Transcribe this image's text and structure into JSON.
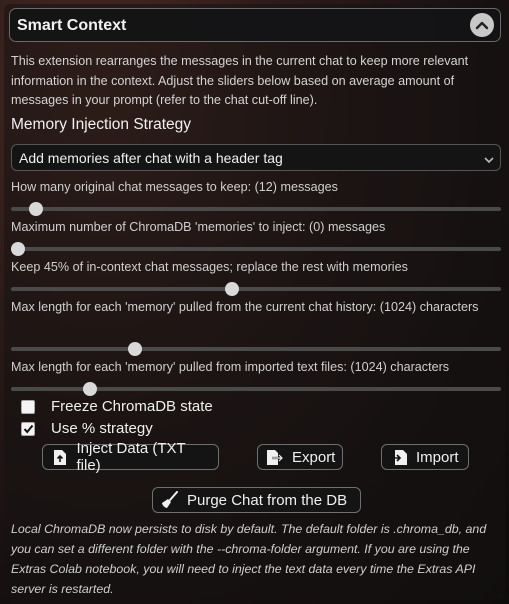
{
  "header": {
    "title": "Smart Context"
  },
  "description": "This extension rearranges the messages in the current chat to keep more relevant information in the context. Adjust the sliders below based on average amount of messages in your prompt (refer to the chat cut-off line).",
  "strategy": {
    "title": "Memory Injection Strategy",
    "selected": "Add memories after chat with a header tag"
  },
  "sliders": [
    {
      "label": "How many original chat messages to keep: (12) messages",
      "fraction": 0.038
    },
    {
      "label": "Maximum number of ChromaDB 'memories' to inject: (0) messages",
      "fraction": 0.0
    },
    {
      "label": "Keep 45% of in-context chat messages; replace the rest with memories",
      "fraction": 0.45
    },
    {
      "label": "Max length for each 'memory' pulled from the current chat history: (1024) characters",
      "fraction": 0.245
    },
    {
      "label": "Max length for each 'memory' pulled from imported text files: (1024) characters",
      "fraction": 0.152
    }
  ],
  "checkboxes": [
    {
      "label": "Freeze ChromaDB state",
      "checked": false
    },
    {
      "label": "Use % strategy",
      "checked": true
    }
  ],
  "buttons": {
    "inject": "Inject Data (TXT file)",
    "export": "Export",
    "import": "Import",
    "purge": "Purge Chat from the DB"
  },
  "note": "Local ChromaDB now persists to disk by default. The default folder is .chroma_db, and you can set a different folder with the --chroma-folder argument. If you are using the Extras Colab notebook, you will need to inject the text data every time the Extras API server is restarted."
}
